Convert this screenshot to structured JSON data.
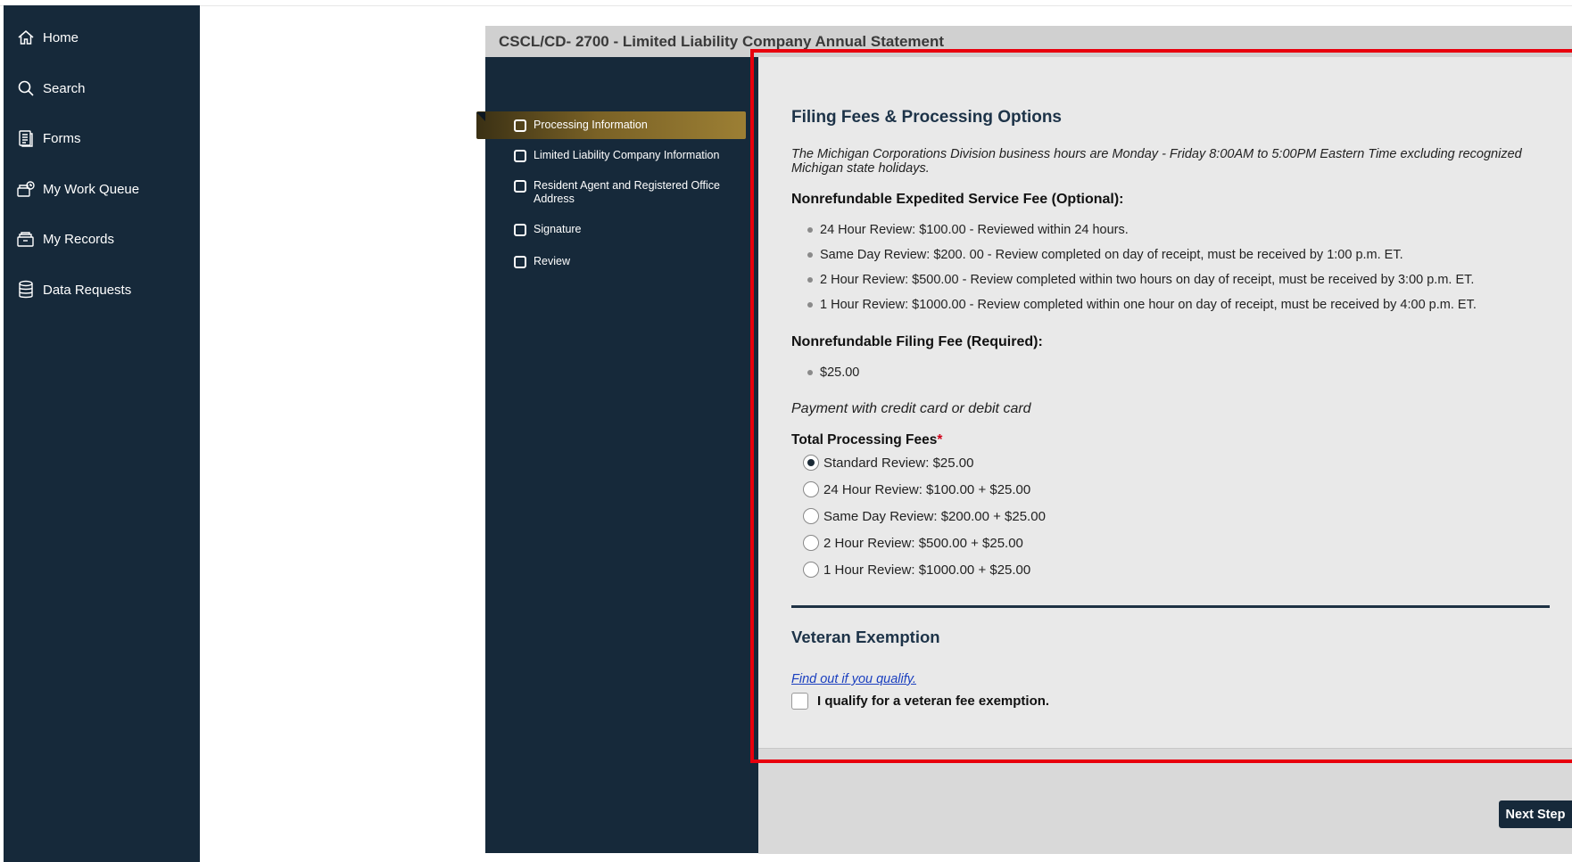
{
  "sidebar": {
    "items": [
      {
        "label": "Home",
        "icon": "home-icon"
      },
      {
        "label": "Search",
        "icon": "search-icon"
      },
      {
        "label": "Forms",
        "icon": "forms-icon"
      },
      {
        "label": "My Work Queue",
        "icon": "work-queue-icon"
      },
      {
        "label": "My Records",
        "icon": "records-icon"
      },
      {
        "label": "Data Requests",
        "icon": "database-icon"
      }
    ]
  },
  "form": {
    "title": "CSCL/CD- 2700 - Limited Liability Company Annual Statement",
    "steps": [
      {
        "label": "Processing Information",
        "active": true
      },
      {
        "label": "Limited Liability Company Information"
      },
      {
        "label": "Resident Agent and Registered Office Address"
      },
      {
        "label": "Signature"
      },
      {
        "label": "Review"
      }
    ]
  },
  "filing": {
    "heading": "Filing Fees & Processing Options",
    "hours_note": "The Michigan Corporations Division business hours are Monday - Friday 8:00AM to 5:00PM Eastern Time excluding recognized Michigan state holidays.",
    "expedited_heading": "Nonrefundable Expedited Service Fee (Optional):",
    "expedited_items": [
      "24 Hour Review: $100.00 - Reviewed within 24 hours.",
      "Same Day Review: $200. 00 - Review completed on day of receipt, must be received by 1:00 p.m. ET.",
      "2 Hour Review: $500.00 - Review completed within two hours on day of receipt, must be received by 3:00 p.m. ET.",
      "1 Hour Review: $1000.00 - Review completed within one hour on day of receipt, must be received by 4:00 p.m. ET."
    ],
    "filing_fee_heading": "Nonrefundable Filing Fee (Required):",
    "filing_fee_items": [
      "$25.00"
    ],
    "payment_note": "Payment with credit card or debit card",
    "total_label": "Total Processing Fees",
    "required_mark": "*",
    "options": [
      {
        "label": "Standard Review: $25.00",
        "selected": true
      },
      {
        "label": "24 Hour Review: $100.00 + $25.00"
      },
      {
        "label": "Same Day Review: $200.00 + $25.00"
      },
      {
        "label": "2 Hour Review: $500.00 + $25.00"
      },
      {
        "label": "1 Hour Review: $1000.00 + $25.00"
      }
    ]
  },
  "veteran": {
    "heading": "Veteran Exemption",
    "link": "Find out if you qualify.",
    "checkbox_label": "I qualify for a veteran fee exemption."
  },
  "footer": {
    "next_label": "Next Step"
  },
  "colors": {
    "sidebar_bg": "#16293a",
    "active_step": "#9c7f34",
    "highlight": "#e8000d",
    "link": "#1a3fbf"
  }
}
